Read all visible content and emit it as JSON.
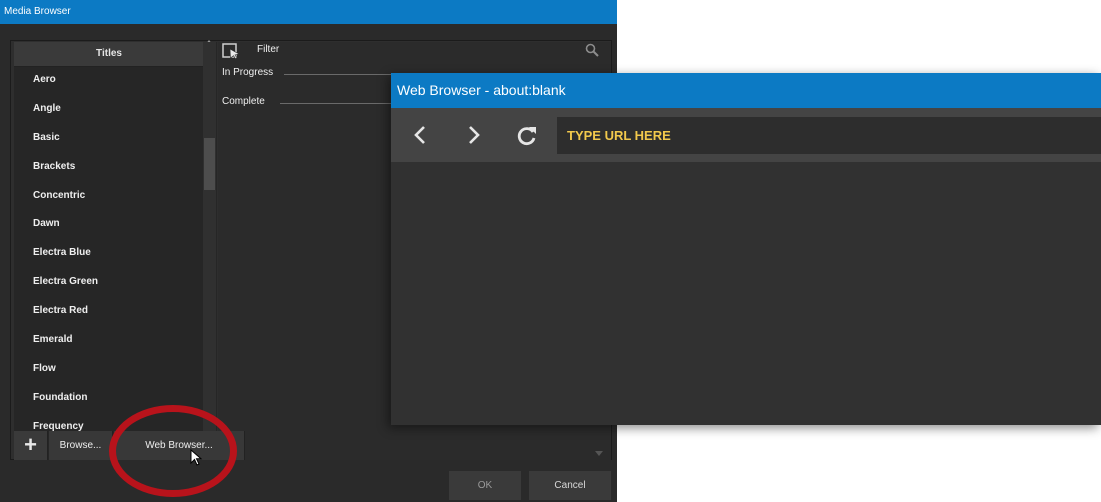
{
  "media_browser": {
    "window_title": "Media Browser",
    "titles_header": "Titles",
    "titles": [
      "Aero",
      "Angle",
      "Basic",
      "Brackets",
      "Concentric",
      "Dawn",
      "Electra Blue",
      "Electra Green",
      "Electra Red",
      "Emerald",
      "Flow",
      "Foundation",
      "Frequency"
    ],
    "filter_label": "Filter",
    "groups": [
      "In Progress",
      "Complete"
    ],
    "buttons": {
      "add": "+",
      "browse": "Browse...",
      "web_browser": "Web Browser...",
      "ok": "OK",
      "cancel": "Cancel"
    }
  },
  "web_browser": {
    "window_title": "Web Browser - about:blank",
    "url_placeholder": "TYPE URL HERE",
    "icons": [
      "back-icon",
      "forward-icon",
      "reload-icon"
    ]
  },
  "colors": {
    "titlebar": "#0c7ac4",
    "url_text": "#f2c94c",
    "highlight_circle": "#b8131b"
  }
}
